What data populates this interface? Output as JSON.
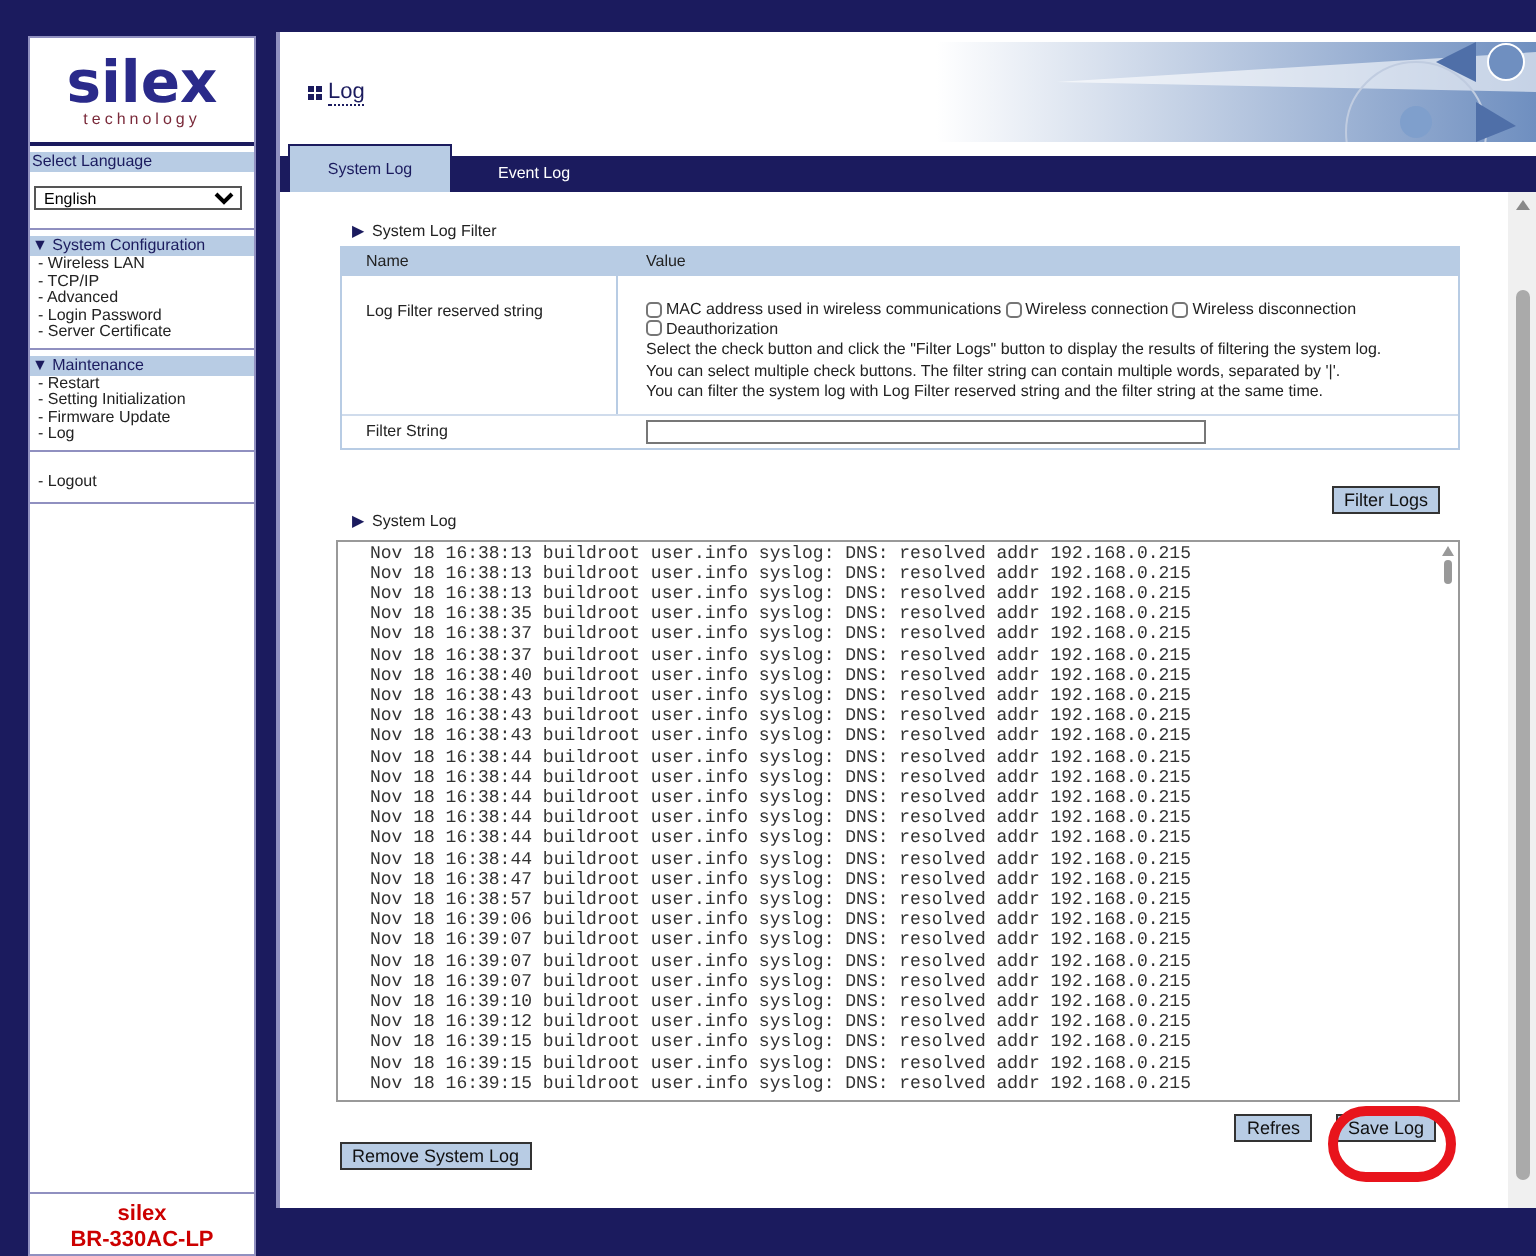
{
  "sidebar": {
    "logo": {
      "word": "silex",
      "tagline": "technology"
    },
    "language": {
      "label": "Select Language",
      "value": "English"
    },
    "sections": [
      {
        "title": "▼ System Configuration",
        "items": [
          {
            "label": "- Wireless LAN"
          },
          {
            "label": "- TCP/IP"
          },
          {
            "label": "- Advanced"
          },
          {
            "label": "- Login Password"
          },
          {
            "label": "- Server Certificate"
          }
        ]
      },
      {
        "title": "▼ Maintenance",
        "items": [
          {
            "label": "- Restart"
          },
          {
            "label": "- Setting Initialization"
          },
          {
            "label": "- Firmware Update"
          },
          {
            "label": "- Log"
          }
        ]
      }
    ],
    "logout": "- Logout",
    "footer": [
      "silex",
      "BR-330AC-LP"
    ]
  },
  "page_title": "Log",
  "tabs": [
    {
      "label": "System Log",
      "selected": true
    },
    {
      "label": "Event Log",
      "selected": false
    }
  ],
  "filter": {
    "marker": "▶",
    "heading": "System Log Filter",
    "columns": [
      "Name",
      "Value"
    ],
    "reserved_label": "Log Filter reserved string",
    "checkboxes": [
      {
        "label": "MAC address used in wireless communications",
        "checked": false
      },
      {
        "label": "Wireless connection",
        "checked": false
      },
      {
        "label": "Wireless disconnection",
        "checked": false
      },
      {
        "label": "Deauthorization",
        "checked": false
      }
    ],
    "help": [
      "Select the check button and click the \"Filter Logs\" button to display the results of filtering the system log.",
      "You can select multiple check buttons. The filter string can contain multiple words, separated by '|'.",
      "You can filter the system log with Log Filter reserved string and the filter string at the same time."
    ],
    "string_label": "Filter String",
    "button": "Filter Logs"
  },
  "log": {
    "marker": "▶",
    "heading": "System Log",
    "lines": [
      "Nov 18 16:38:13 buildroot user.info syslog: DNS: resolved addr 192.168.0.215",
      "Nov 18 16:38:13 buildroot user.info syslog: DNS: resolved addr 192.168.0.215",
      "Nov 18 16:38:13 buildroot user.info syslog: DNS: resolved addr 192.168.0.215",
      "Nov 18 16:38:35 buildroot user.info syslog: DNS: resolved addr 192.168.0.215",
      "Nov 18 16:38:37 buildroot user.info syslog: DNS: resolved addr 192.168.0.215",
      "Nov 18 16:38:37 buildroot user.info syslog: DNS: resolved addr 192.168.0.215",
      "Nov 18 16:38:40 buildroot user.info syslog: DNS: resolved addr 192.168.0.215",
      "Nov 18 16:38:43 buildroot user.info syslog: DNS: resolved addr 192.168.0.215",
      "Nov 18 16:38:43 buildroot user.info syslog: DNS: resolved addr 192.168.0.215",
      "Nov 18 16:38:43 buildroot user.info syslog: DNS: resolved addr 192.168.0.215",
      "Nov 18 16:38:44 buildroot user.info syslog: DNS: resolved addr 192.168.0.215",
      "Nov 18 16:38:44 buildroot user.info syslog: DNS: resolved addr 192.168.0.215",
      "Nov 18 16:38:44 buildroot user.info syslog: DNS: resolved addr 192.168.0.215",
      "Nov 18 16:38:44 buildroot user.info syslog: DNS: resolved addr 192.168.0.215",
      "Nov 18 16:38:44 buildroot user.info syslog: DNS: resolved addr 192.168.0.215",
      "Nov 18 16:38:44 buildroot user.info syslog: DNS: resolved addr 192.168.0.215",
      "Nov 18 16:38:47 buildroot user.info syslog: DNS: resolved addr 192.168.0.215",
      "Nov 18 16:38:57 buildroot user.info syslog: DNS: resolved addr 192.168.0.215",
      "Nov 18 16:39:06 buildroot user.info syslog: DNS: resolved addr 192.168.0.215",
      "Nov 18 16:39:07 buildroot user.info syslog: DNS: resolved addr 192.168.0.215",
      "Nov 18 16:39:07 buildroot user.info syslog: DNS: resolved addr 192.168.0.215",
      "Nov 18 16:39:07 buildroot user.info syslog: DNS: resolved addr 192.168.0.215",
      "Nov 18 16:39:10 buildroot user.info syslog: DNS: resolved addr 192.168.0.215",
      "Nov 18 16:39:12 buildroot user.info syslog: DNS: resolved addr 192.168.0.215",
      "Nov 18 16:39:15 buildroot user.info syslog: DNS: resolved addr 192.168.0.215",
      "Nov 18 16:39:15 buildroot user.info syslog: DNS: resolved addr 192.168.0.215",
      "Nov 18 16:39:15 buildroot user.info syslog: DNS: resolved addr 192.168.0.215"
    ],
    "buttons": [
      "Refres",
      "Save Log"
    ],
    "remove_button": "Remove System Log"
  }
}
